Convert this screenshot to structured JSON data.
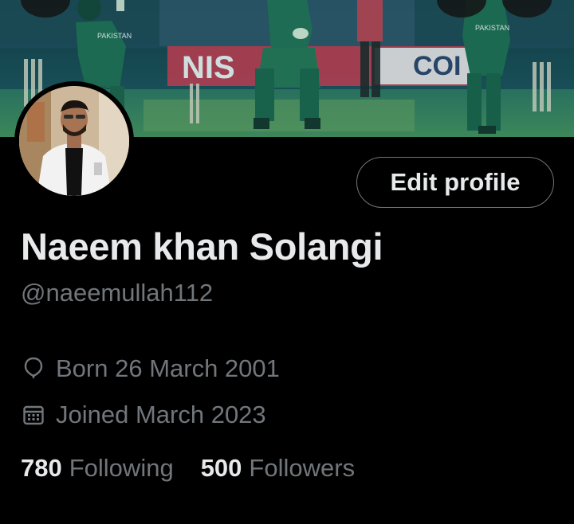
{
  "banner": {
    "sign_left": "NIS",
    "sign_right": "COI",
    "jersey_text": "PAKISTAN"
  },
  "profile": {
    "display_name": "Naeem khan Solangi",
    "handle": "@naeemullah112",
    "born": "Born 26 March 2001",
    "joined": "Joined March 2023"
  },
  "actions": {
    "edit_profile_label": "Edit profile"
  },
  "stats": {
    "following_count": "780",
    "following_label": "Following",
    "followers_count": "500",
    "followers_label": "Followers"
  },
  "icons": {
    "back": "back-arrow-icon",
    "search": "search-icon",
    "more": "more-icon",
    "born": "balloon-icon",
    "joined": "calendar-icon"
  },
  "colors": {
    "background": "#000000",
    "primary_text": "#e7e9ea",
    "secondary_text": "#71767b",
    "button_border": "#6e767d"
  }
}
